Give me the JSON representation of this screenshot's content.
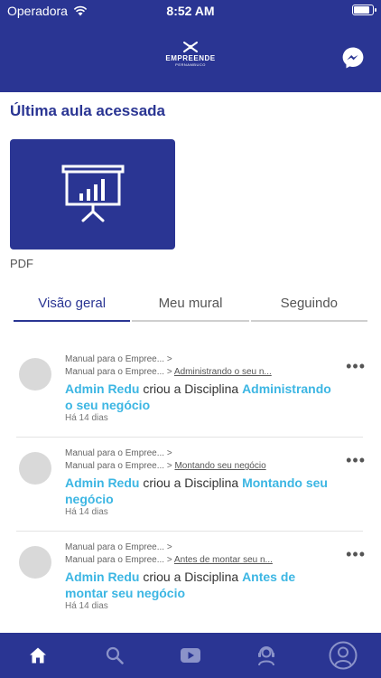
{
  "status": {
    "carrier": "Operadora",
    "time": "8:52 AM",
    "battery_level": 0.85
  },
  "header": {
    "logo_text": "EMPREENDE",
    "logo_subtext": "PERNAMBUCO",
    "messenger_icon": "messenger-icon"
  },
  "last_lesson": {
    "title": "Última aula acessada",
    "caption": "PDF",
    "icon": "presentation-chart-icon"
  },
  "tabs": [
    {
      "label": "Visão geral",
      "active": true
    },
    {
      "label": "Meu mural",
      "active": false
    },
    {
      "label": "Seguindo",
      "active": false
    }
  ],
  "feed": [
    {
      "crumb1": "Manual para o Empree... >",
      "crumb2_prefix": "Manual para o Empree... >",
      "crumb2_link": "Administrando o seu n...",
      "author": "Admin Redu",
      "verb": " criou a Disciplina ",
      "target": "Administrando o seu negócio",
      "time": "Há 14 dias",
      "more": "•••"
    },
    {
      "crumb1": "Manual para o Empree... >",
      "crumb2_prefix": "Manual para o Empree... >",
      "crumb2_link": "Montando seu negócio",
      "author": "Admin Redu",
      "verb": " criou a Disciplina ",
      "target": "Montando seu negócio",
      "time": "Há 14 dias",
      "more": "•••"
    },
    {
      "crumb1": "Manual para o Empree... >",
      "crumb2_prefix": "Manual para o Empree... >",
      "crumb2_link": "Antes de montar seu n...",
      "author": "Admin Redu",
      "verb": " criou a Disciplina ",
      "target": "Antes de montar seu negócio",
      "time": "Há 14 dias",
      "more": "•••"
    }
  ],
  "tabbar": [
    "home-icon",
    "search-icon",
    "video-icon",
    "support-icon",
    "profile-icon"
  ],
  "colors": {
    "brand": "#2a3593",
    "accent": "#3cb6e3"
  }
}
